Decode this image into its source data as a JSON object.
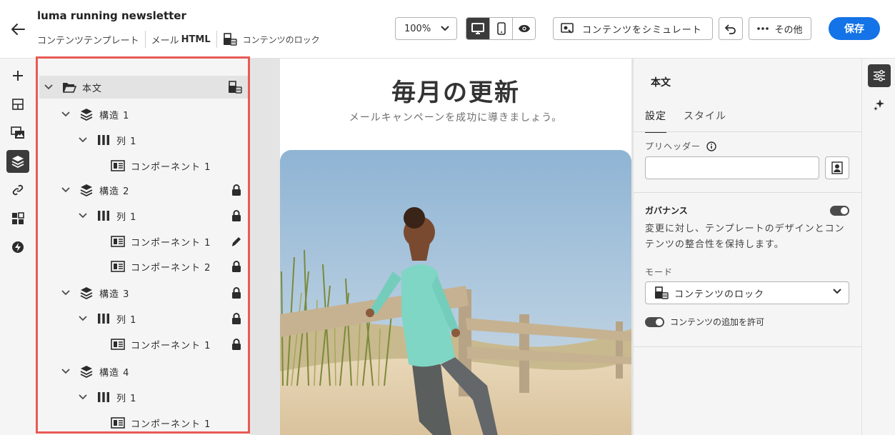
{
  "header": {
    "title": "luma running newsletter",
    "template_label": "コンテンツテンプレート",
    "type_prefix": "メール",
    "type_suffix": "HTML",
    "lock_label": "コンテンツのロック",
    "zoom": "100%",
    "simulate_label": "コンテンツをシミュレート",
    "more_label": "その他",
    "save_label": "保存"
  },
  "left_rail": {
    "items": [
      "add-icon",
      "structure-icon",
      "fragment-icon",
      "layers-icon",
      "link-icon",
      "components-icon",
      "bolt-icon"
    ],
    "active": "layers-icon"
  },
  "layers": {
    "root": {
      "label": "本文",
      "state": "lock-settings-icon"
    },
    "rows": [
      {
        "label": "構造 1",
        "state": ""
      },
      {
        "label": "列 1",
        "state": ""
      },
      {
        "label": "コンポーネント 1",
        "state": ""
      },
      {
        "label": "構造 2",
        "state": "lock-icon"
      },
      {
        "label": "列 1",
        "state": "lock-icon"
      },
      {
        "label": "コンポーネント 1",
        "state": "pencil-icon"
      },
      {
        "label": "コンポーネント 2",
        "state": "lock-icon"
      },
      {
        "label": "構造 3",
        "state": "lock-icon"
      },
      {
        "label": "列 1",
        "state": "lock-icon"
      },
      {
        "label": "コンポーネント 1",
        "state": "lock-icon"
      },
      {
        "label": "構造 4",
        "state": ""
      },
      {
        "label": "列 1",
        "state": ""
      },
      {
        "label": "コンポーネント 1",
        "state": ""
      }
    ],
    "highlight_color": "#e85a55"
  },
  "canvas": {
    "title": "毎月の更新",
    "subtitle": "メールキャンペーンを成功に導きましょう。"
  },
  "properties": {
    "title": "本文",
    "tabs": [
      {
        "label": "設定",
        "active": true
      },
      {
        "label": "スタイル",
        "active": false
      }
    ],
    "preheader_label": "プリヘッダー",
    "preheader_value": "",
    "governance_title": "ガバナンス",
    "governance_enabled": true,
    "governance_desc": "変更に対し、テンプレートのデザインとコンテンツの整合性を保持します。",
    "mode_label": "モード",
    "mode_value": "コンテンツのロック",
    "allow_add_label": "コンテンツの追加を許可",
    "allow_add_enabled": true
  },
  "right_rail": {
    "items": [
      "sliders-icon",
      "sparkle-icon"
    ],
    "active": "sliders-icon"
  },
  "colors": {
    "accent": "#1473e6",
    "dark": "#3b3b3b",
    "highlight": "#e85a55"
  }
}
